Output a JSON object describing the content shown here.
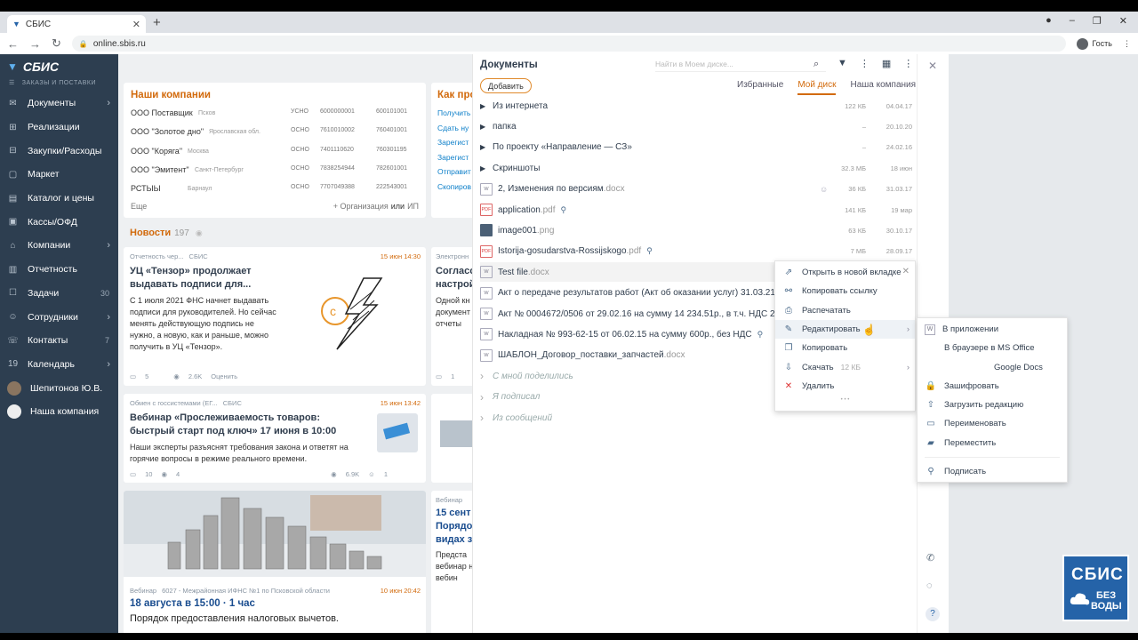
{
  "browser": {
    "tab_title": "СБИС",
    "url": "online.sbis.ru",
    "profile": "Гость"
  },
  "nav": {
    "logo": "СБИС",
    "subtitle": "ЗАКАЗЫ И ПОСТАВКИ",
    "items": [
      {
        "label": "Документы",
        "icon": "document-icon",
        "chev": "›"
      },
      {
        "label": "Реализации",
        "icon": "sales-icon"
      },
      {
        "label": "Закупки/Расходы",
        "icon": "purchase-icon"
      },
      {
        "label": "Маркет",
        "icon": "market-icon"
      },
      {
        "label": "Каталог и цены",
        "icon": "catalog-icon"
      },
      {
        "label": "Кассы/ОФД",
        "icon": "cashbox-icon"
      },
      {
        "label": "Компании",
        "icon": "companies-icon",
        "chev": "›"
      },
      {
        "label": "Отчетность",
        "icon": "reports-icon"
      },
      {
        "label": "Задачи",
        "icon": "tasks-icon",
        "count": "30"
      },
      {
        "label": "Сотрудники",
        "icon": "employees-icon",
        "chev": "›"
      },
      {
        "label": "Контакты",
        "icon": "contacts-icon",
        "count": "7"
      },
      {
        "label": "Календарь",
        "icon": "calendar-icon",
        "chev": "›",
        "num": "19"
      },
      {
        "label": "Шепитонов Ю.В.",
        "icon": "user-avatar"
      },
      {
        "label": "Наша компания",
        "icon": "company-avatar"
      }
    ]
  },
  "companies": {
    "title": "Наши компании",
    "rows": [
      {
        "name": "ООО Поставщик",
        "city": "Псков",
        "tax": "УСНО",
        "inn": "6000000001",
        "kpp": "600101001"
      },
      {
        "name": "ООО \"Золотое дно\"",
        "city": "Ярославская обл.",
        "tax": "ОСНО",
        "inn": "7610010002",
        "kpp": "760401001"
      },
      {
        "name": "ООО \"Коряга\"",
        "city": "Москва",
        "tax": "ОСНО",
        "inn": "7401110620",
        "kpp": "760301195"
      },
      {
        "name": "ООО \"Эмитент\"",
        "city": "Санкт-Петербург",
        "tax": "ОСНО",
        "inn": "7838254944",
        "kpp": "782601001"
      },
      {
        "name": "РСТЫЫ",
        "city": "Барнаул",
        "tax": "ОСНО",
        "inn": "7707049388",
        "kpp": "222543001"
      }
    ],
    "more": "Еще",
    "add": "+ Организация",
    "or": "или",
    "ip": "ИП"
  },
  "howto": {
    "title": "Как про",
    "links": [
      "Получить",
      "Сдать ну",
      "Зарегист",
      "Зарегист",
      "Отправит",
      "Скопиров"
    ]
  },
  "news": {
    "title": "Новости",
    "count": "197",
    "items": [
      {
        "source": "Отчетность чер...",
        "author": "СБИС",
        "date": "15 июн 14:30",
        "title": "УЦ «Тензор» продолжает выдавать подписи для...",
        "text": "С 1 июля 2021 ФНС начнет выдавать подписи для руководителей. Но сейчас менять действующую подпись не нужно, а новую, как и раньше, можно получить в УЦ «Тензор».",
        "comments": "5",
        "views": "2.6K",
        "rate": "Оценить"
      },
      {
        "source": "Обмен с госсистемами (ЕГ...",
        "author": "СБИС",
        "date": "15 июн 13:42",
        "title": "Вебинар «Прослеживаемость товаров: быстрый старт под ключ» 17 июня в 10:00",
        "text": "Наши эксперты разъяснят требования закона и ответят на горячие вопросы в режиме реального времени.",
        "comments": "10",
        "likes": "4",
        "views": "6.9K",
        "score": "1"
      },
      {
        "source": "Вебинар",
        "author": "6027 - Межрайонная ИФНС №1 по Псковской области",
        "date": "10 июн 20:42",
        "title": "18 августа в 15:00 · 1 час",
        "text": "Порядок предоставления налоговых вычетов."
      }
    ]
  },
  "news_right": [
    {
      "source": "Электронн",
      "title": "Согласо настрой",
      "text": "Одной кн документ отчеты",
      "comments": "1"
    },
    {
      "source": "Вебинар",
      "title": "15 сент Порядо видах з",
      "text": "Предста вебинар на вебин"
    }
  ],
  "panel": {
    "title": "Документы",
    "search": "Найти в Моем диске...",
    "add": "Добавить",
    "tabs": [
      "Избранные",
      "Мой диск",
      "Наша компания"
    ],
    "rows": [
      {
        "type": "folder",
        "name": "Из интернета",
        "size": "122 КБ",
        "date": "04.04.17"
      },
      {
        "type": "folder",
        "name": "папка",
        "size": "–",
        "date": "20.10.20"
      },
      {
        "type": "folder",
        "name": "По проекту «Направление — СЗ»",
        "size": "–",
        "date": "24.02.16"
      },
      {
        "type": "folder",
        "name": "Скриншоты",
        "size": "32.3 МБ",
        "date": "18 июн"
      },
      {
        "type": "doc",
        "name": "2, Изменения по версиям",
        "ext": ".docx",
        "size": "36 КБ",
        "date": "31.03.17",
        "shared": true
      },
      {
        "type": "pdf",
        "name": "application",
        "ext": ".pdf",
        "size": "141 КБ",
        "date": "19 мар",
        "badge": true
      },
      {
        "type": "img",
        "name": "image001",
        "ext": ".png",
        "size": "63 КБ",
        "date": "30.10.17"
      },
      {
        "type": "pdf",
        "name": "Istorija-gosudarstva-Rossijskogo",
        "ext": ".pdf",
        "size": "7 МБ",
        "date": "28.09.17",
        "badge": true
      },
      {
        "type": "doc",
        "name": "Test file",
        "ext": ".docx",
        "selected": true
      },
      {
        "type": "doc",
        "name": "Акт о передаче результатов работ (Акт об оказании услуг) 31.03.21 № 2"
      },
      {
        "type": "doc",
        "name": "Акт № 0004672/0506 от 29.02.16 на сумму 14 234.51р., в т.ч. НДС 2 171"
      },
      {
        "type": "doc",
        "name": "Накладная № 993-62-15 от 06.02.15 на сумму 600р., без НДС",
        "badge": true
      },
      {
        "type": "doc",
        "name": "ШАБЛОН_Договор_поставки_запчастей",
        "ext": ".docx"
      },
      {
        "type": "group",
        "name": "С мной поделились"
      },
      {
        "type": "group",
        "name": "Я подписал"
      },
      {
        "type": "group",
        "name": "Из сообщений"
      }
    ]
  },
  "context_menu": {
    "items": [
      {
        "label": "Открыть в новой вкладке",
        "icon": "open-external-icon"
      },
      {
        "label": "Копировать ссылку",
        "icon": "link-icon"
      },
      {
        "label": "Распечатать",
        "icon": "print-icon"
      },
      {
        "label": "Редактировать",
        "icon": "pencil-icon",
        "arrow": "›",
        "highlighted": true
      },
      {
        "label": "Копировать",
        "icon": "copy-icon"
      },
      {
        "label": "Скачать",
        "icon": "download-icon",
        "extra": "12 КБ",
        "arrow": "›"
      },
      {
        "label": "Удалить",
        "icon": "delete-icon"
      }
    ],
    "more": "• • •"
  },
  "submenu": {
    "items": [
      {
        "label": "В приложении",
        "icon": "word-icon"
      },
      {
        "label": "В браузере в MS Office",
        "icon": ""
      },
      {
        "label": "Google Docs",
        "icon": ""
      },
      {
        "label": "Зашифровать",
        "icon": "lock-icon"
      },
      {
        "label": "Загрузить редакцию",
        "icon": "upload-icon"
      },
      {
        "label": "Переименовать",
        "icon": "rename-icon"
      },
      {
        "label": "Переместить",
        "icon": "move-icon"
      },
      {
        "label": "Подписать",
        "icon": "sign-icon"
      }
    ]
  },
  "promo": {
    "brand": "СБИС",
    "line1": "БЕЗ",
    "line2": "ВОДЫ"
  },
  "colors": {
    "nav_bg": "#2d3e50",
    "accent": "#d26a0c",
    "link": "#0d7fc9",
    "promo": "#2563a8"
  }
}
